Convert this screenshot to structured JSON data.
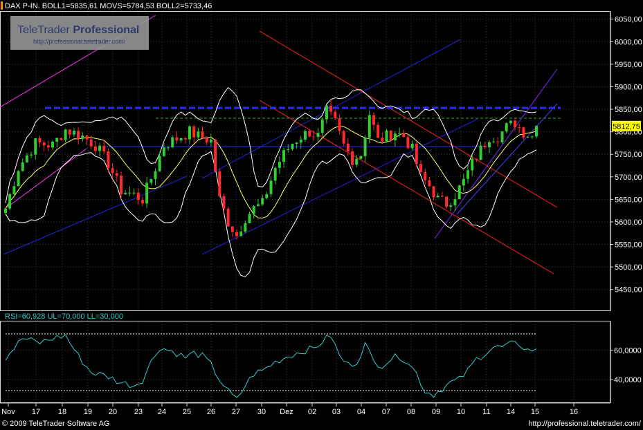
{
  "header": {
    "main_title": "DAX P-IN.  BOLL1=5835,61 MOVS=5784,53 BOLL2=5733,46",
    "rsi_title": "RSI=60,928 UL=70,000 LL=30,000"
  },
  "watermark": {
    "brand_light": "TeleTrader ",
    "brand_bold": "Professional",
    "url": "http://professional.teletrader.com/"
  },
  "footer": {
    "copyright": "© 2009 TeleTrader Software AG",
    "url": "http://professional.teletrader.com/"
  },
  "colors": {
    "background": "#000000",
    "candle_up": "#33cc33",
    "candle_down": "#ff2a2a",
    "bollinger": "#ffffff",
    "moving_average": "#ffff66",
    "rsi_line": "#33cccc",
    "channel_red": "#ff2020",
    "channel_blue": "#2222dd",
    "channel_magenta": "#ff33ff",
    "resistance_blue": "#2a2aff",
    "resistance_green": "#33aa33",
    "last_price_box": "#ffff00"
  },
  "chart_data": {
    "type": "candlestick",
    "price_axis": {
      "ylim": [
        5402,
        6068
      ],
      "ticks": [
        5450,
        5500,
        5550,
        5600,
        5650,
        5700,
        5750,
        5800,
        5850,
        5900,
        5950,
        6000,
        6050
      ],
      "tick_labels": [
        "5450,00",
        "5500,00",
        "5550,00",
        "5600,00",
        "5650,00",
        "5700,00",
        "5750,00",
        "5800,00",
        "5850,00",
        "5900,00",
        "5950,00",
        "6000,00",
        "6050,00"
      ]
    },
    "last_price": 5812.75,
    "last_price_label": "5812,75",
    "x_labels": [
      "Nov",
      "17",
      "18",
      "19",
      "20",
      "23",
      "24",
      "25",
      "26",
      "27",
      "30",
      "Dez",
      "02",
      "03",
      "04",
      "07",
      "08",
      "09",
      "10",
      "11",
      "14",
      "15",
      "16"
    ],
    "price_anchors": [
      [
        0,
        5630
      ],
      [
        3,
        5720
      ],
      [
        7,
        5775
      ],
      [
        11,
        5770
      ],
      [
        14,
        5805
      ],
      [
        18,
        5790
      ],
      [
        21,
        5770
      ],
      [
        24,
        5730
      ],
      [
        27,
        5670
      ],
      [
        30,
        5660
      ],
      [
        32,
        5650
      ],
      [
        35,
        5720
      ],
      [
        37,
        5770
      ],
      [
        39,
        5780
      ],
      [
        41,
        5790
      ],
      [
        43,
        5800
      ],
      [
        45,
        5790
      ],
      [
        48,
        5780
      ],
      [
        50,
        5650
      ],
      [
        52,
        5600
      ],
      [
        54,
        5570
      ],
      [
        56,
        5610
      ],
      [
        58,
        5630
      ],
      [
        60,
        5640
      ],
      [
        63,
        5720
      ],
      [
        65,
        5750
      ],
      [
        67,
        5775
      ],
      [
        69,
        5790
      ],
      [
        71,
        5800
      ],
      [
        73,
        5790
      ],
      [
        75,
        5845
      ],
      [
        77,
        5820
      ],
      [
        79,
        5770
      ],
      [
        81,
        5740
      ],
      [
        83,
        5750
      ],
      [
        85,
        5840
      ],
      [
        87,
        5780
      ],
      [
        89,
        5790
      ],
      [
        91,
        5800
      ],
      [
        93,
        5790
      ],
      [
        95,
        5760
      ],
      [
        97,
        5700
      ],
      [
        99,
        5680
      ],
      [
        101,
        5650
      ],
      [
        103,
        5640
      ],
      [
        105,
        5660
      ],
      [
        107,
        5690
      ],
      [
        109,
        5730
      ],
      [
        111,
        5760
      ],
      [
        113,
        5790
      ],
      [
        115,
        5790
      ],
      [
        117,
        5810
      ],
      [
        119,
        5820
      ],
      [
        121,
        5800
      ],
      [
        123,
        5790
      ],
      [
        124,
        5812.75
      ]
    ],
    "rsi_axis": {
      "ylim": [
        24,
        80
      ],
      "ticks": [
        40,
        60
      ],
      "tick_labels": [
        "40,0000",
        "60,0000"
      ],
      "upper": 70,
      "lower": 30
    },
    "rsi_anchors": [
      [
        0,
        55
      ],
      [
        4,
        68
      ],
      [
        8,
        65
      ],
      [
        11,
        68
      ],
      [
        14,
        70
      ],
      [
        17,
        56
      ],
      [
        20,
        45
      ],
      [
        24,
        42
      ],
      [
        27,
        38
      ],
      [
        30,
        36
      ],
      [
        32,
        40
      ],
      [
        34,
        52
      ],
      [
        36,
        62
      ],
      [
        38,
        60
      ],
      [
        40,
        58
      ],
      [
        42,
        55
      ],
      [
        44,
        58
      ],
      [
        46,
        56
      ],
      [
        48,
        50
      ],
      [
        50,
        40
      ],
      [
        52,
        32
      ],
      [
        54,
        26
      ],
      [
        56,
        36
      ],
      [
        58,
        44
      ],
      [
        60,
        46
      ],
      [
        63,
        52
      ],
      [
        66,
        56
      ],
      [
        68,
        58
      ],
      [
        70,
        60
      ],
      [
        72,
        61
      ],
      [
        74,
        66
      ],
      [
        76,
        70
      ],
      [
        78,
        56
      ],
      [
        80,
        50
      ],
      [
        82,
        52
      ],
      [
        84,
        64
      ],
      [
        86,
        52
      ],
      [
        88,
        50
      ],
      [
        90,
        54
      ],
      [
        92,
        56
      ],
      [
        94,
        52
      ],
      [
        96,
        44
      ],
      [
        98,
        32
      ],
      [
        100,
        30
      ],
      [
        102,
        34
      ],
      [
        104,
        38
      ],
      [
        106,
        40
      ],
      [
        108,
        46
      ],
      [
        110,
        54
      ],
      [
        112,
        58
      ],
      [
        114,
        62
      ],
      [
        116,
        62
      ],
      [
        118,
        64
      ],
      [
        120,
        64
      ],
      [
        122,
        60
      ],
      [
        124,
        60.9
      ]
    ]
  }
}
